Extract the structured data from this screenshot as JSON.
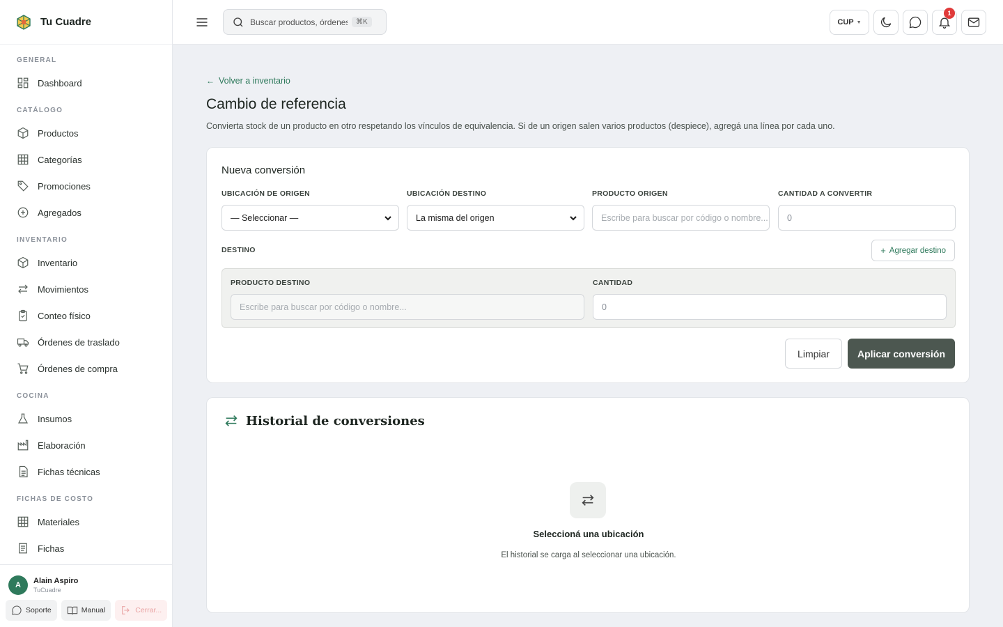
{
  "brand": {
    "name": "Tu Cuadre"
  },
  "sidebar": {
    "sections": [
      {
        "title": "GENERAL",
        "items": [
          {
            "label": "Dashboard",
            "icon": "dashboard-icon"
          }
        ]
      },
      {
        "title": "CATÁLOGO",
        "items": [
          {
            "label": "Productos",
            "icon": "box-icon"
          },
          {
            "label": "Categorías",
            "icon": "grid-icon"
          },
          {
            "label": "Promociones",
            "icon": "tag-icon"
          },
          {
            "label": "Agregados",
            "icon": "plus-circle-icon"
          }
        ]
      },
      {
        "title": "INVENTARIO",
        "items": [
          {
            "label": "Inventario",
            "icon": "box-icon"
          },
          {
            "label": "Movimientos",
            "icon": "swap-icon"
          },
          {
            "label": "Conteo físico",
            "icon": "clipboard-icon"
          },
          {
            "label": "Órdenes de traslado",
            "icon": "truck-icon"
          },
          {
            "label": "Órdenes de compra",
            "icon": "cart-icon"
          }
        ]
      },
      {
        "title": "COCINA",
        "items": [
          {
            "label": "Insumos",
            "icon": "flask-icon"
          },
          {
            "label": "Elaboración",
            "icon": "factory-icon"
          },
          {
            "label": "Fichas técnicas",
            "icon": "document-icon"
          }
        ]
      },
      {
        "title": "FICHAS DE COSTO",
        "items": [
          {
            "label": "Materiales",
            "icon": "grid-icon"
          },
          {
            "label": "Fichas",
            "icon": "document-icon"
          }
        ]
      }
    ],
    "user": {
      "initial": "A",
      "name": "Alain Aspiro",
      "org": "TuCuadre"
    },
    "footer": {
      "support": "Soporte",
      "manual": "Manual",
      "logout": "Cerrar..."
    }
  },
  "topbar": {
    "search_placeholder": "Buscar productos, órdenes...",
    "shortcut": "⌘K",
    "currency": "CUP",
    "notifications_count": "1"
  },
  "page": {
    "back_label": "Volver a inventario",
    "title": "Cambio de referencia",
    "subtitle": "Convierta stock de un producto en otro respetando los vínculos de equivalencia. Si de un origen salen varios productos (despiece), agregá una línea por cada uno."
  },
  "form": {
    "card_title": "Nueva conversión",
    "origin_location": {
      "label": "UBICACIÓN DE ORIGEN",
      "value": "— Seleccionar —"
    },
    "dest_location": {
      "label": "UBICACIÓN DESTINO",
      "value": "La misma del origen"
    },
    "origin_product": {
      "label": "PRODUCTO ORIGEN",
      "placeholder": "Escribe para buscar por código o nombre..."
    },
    "quantity": {
      "label": "CANTIDAD A CONVERTIR",
      "placeholder": "0"
    },
    "destination_label": "DESTINO",
    "add_destination": "Agregar destino",
    "dest_product": {
      "label": "PRODUCTO DESTINO",
      "placeholder": "Escribe para buscar por código o nombre..."
    },
    "dest_quantity": {
      "label": "CANTIDAD",
      "placeholder": "0"
    },
    "clear_label": "Limpiar",
    "apply_label": "Aplicar conversión"
  },
  "history": {
    "title": "Historial de conversiones",
    "empty_title": "Seleccioná una ubicación",
    "empty_subtitle": "El historial se carga al seleccionar una ubicación."
  },
  "colors": {
    "accent": "#2f7a5c",
    "primary_button": "#4c5750",
    "badge": "#e03a3a"
  }
}
